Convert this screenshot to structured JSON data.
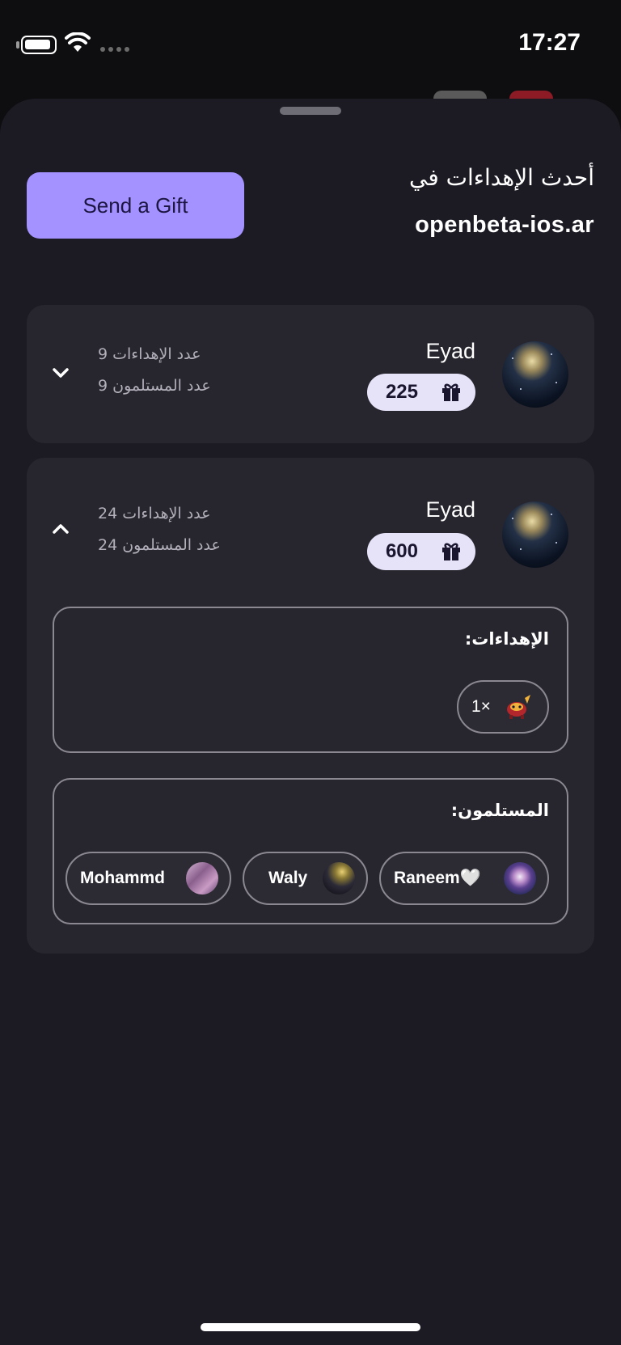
{
  "status_bar": {
    "time": "17:27"
  },
  "header": {
    "send_gift_label": "Send a Gift",
    "title": "أحدث الإهداءات في",
    "subtitle": "openbeta-ios.ar"
  },
  "cards": [
    {
      "expanded": false,
      "sender": "Eyad",
      "gift_count": "225",
      "gifts_label": "عدد الإهداءات 9",
      "recipients_label": "عدد المستلمون 9"
    },
    {
      "expanded": true,
      "sender": "Eyad",
      "gift_count": "600",
      "gifts_label": "عدد الإهداءات 24",
      "recipients_label": "عدد المستلمون 24",
      "gifts_section_title": "الإهداءات:",
      "gift_items": [
        {
          "count": "1×",
          "icon": "gift-item-icon"
        }
      ],
      "recipients_section_title": "المستلمون:",
      "recipients": [
        {
          "name": "Raneem🤍"
        },
        {
          "name": "Waly"
        },
        {
          "name": "Mohammd"
        }
      ]
    }
  ],
  "colors": {
    "accent": "#a392ff",
    "sheet_bg": "#1c1a23",
    "card_bg": "#27252d",
    "pill_bg": "#e6e2f8"
  }
}
